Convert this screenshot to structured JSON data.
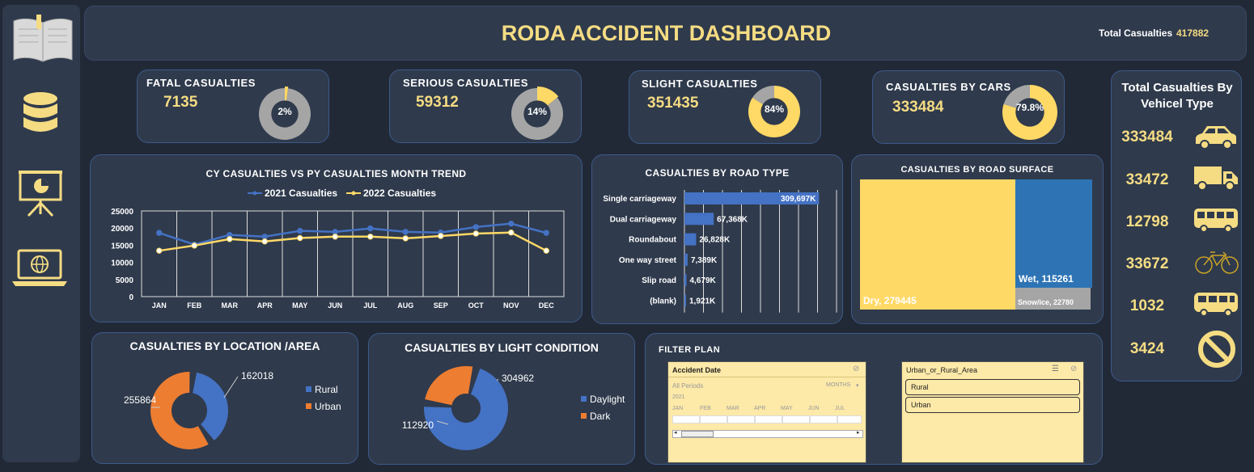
{
  "header": {
    "title": "RODA ACCIDENT DASHBOARD",
    "total_label": "Total Casualties",
    "total_value": "417882"
  },
  "sidebar": {
    "icons": [
      "book-icon",
      "database-icon",
      "presentation-icon",
      "laptop-globe-icon"
    ]
  },
  "kpis": [
    {
      "label": "FATAL CASUALTIES",
      "value": "7135",
      "pct": 2,
      "pct_label": "2%"
    },
    {
      "label": "SERIOUS CASUALTIES",
      "value": "59312",
      "pct": 14,
      "pct_label": "14%"
    },
    {
      "label": "SLIGHT CASUALTIES",
      "value": "351435",
      "pct": 84,
      "pct_label": "84%"
    },
    {
      "label": "CASUALTIES BY CARS",
      "value": "333484",
      "pct": 79.8,
      "pct_label": "79.8%"
    }
  ],
  "colors": {
    "accent": "#f5dc83",
    "blue": "#4472c4",
    "orange": "#ed7d31",
    "grey": "#a5a5a5",
    "yellow": "#ffd966",
    "card": "#2f3a4c",
    "bg": "#222936"
  },
  "trend": {
    "title": "CY CASUALTIES VS PY CASUALTIES MONTH TREND"
  },
  "road_type": {
    "title": "CASUALTIES BY ROAD TYPE"
  },
  "road_surface": {
    "title": "CASUALTIES BY ROAD SURFACE",
    "dry": "Dry, 279445",
    "wet": "Wet, 115261",
    "snow": "Snow/ice, 22780"
  },
  "location": {
    "title": "CASUALTIES BY LOCATION /AREA"
  },
  "light": {
    "title": "CASUALTIES BY  LIGHT CONDITION"
  },
  "vehicle": {
    "title_line1": "Total Casualties By",
    "title_line2": "Vehicel Type",
    "items": [
      {
        "value": "333484",
        "icon": "car-icon"
      },
      {
        "value": "33472",
        "icon": "truck-icon"
      },
      {
        "value": "12798",
        "icon": "bus-icon"
      },
      {
        "value": "33672",
        "icon": "bicycle-icon"
      },
      {
        "value": "1032",
        "icon": "van-icon"
      },
      {
        "value": "3424",
        "icon": "no-entry-icon"
      }
    ]
  },
  "filter": {
    "title": "FILTER PLAN",
    "date_slicer": {
      "title": "Accident  Date",
      "period_label": "All Periods",
      "mode_label": "MONTHS",
      "year": "2021",
      "months": [
        "JAN",
        "FEB",
        "MAR",
        "APR",
        "MAY",
        "JUN",
        "JUL"
      ]
    },
    "area_slicer": {
      "title": "Urban_or_Rural_Area",
      "options": [
        "Rural",
        "Urban"
      ]
    }
  },
  "chart_data": [
    {
      "type": "line",
      "title": "CY CASUALTIES VS PY CASUALTIES MONTH TREND",
      "categories": [
        "JAN",
        "FEB",
        "MAR",
        "APR",
        "MAY",
        "JUN",
        "JUL",
        "AUG",
        "SEP",
        "OCT",
        "NOV",
        "DEC"
      ],
      "series": [
        {
          "name": "2021 Casualties",
          "values": [
            18600,
            15200,
            18000,
            17500,
            19200,
            18900,
            19900,
            18900,
            18700,
            20300,
            21300,
            18600
          ]
        },
        {
          "name": "2022 Casualties",
          "values": [
            13400,
            14900,
            16800,
            16100,
            17100,
            17500,
            17500,
            17000,
            17700,
            18400,
            18700,
            13400
          ]
        }
      ],
      "ylim": [
        0,
        25000
      ],
      "yticks": [
        "0",
        "5000",
        "10000",
        "15000",
        "20000",
        "25000"
      ],
      "grid": true,
      "legend": "top"
    },
    {
      "type": "bar",
      "title": "CASUALTIES BY ROAD TYPE",
      "categories": [
        "Single carriageway",
        "Dual carriageway",
        "Roundabout",
        "One way street",
        "Slip road",
        "(blank)"
      ],
      "values": [
        309697,
        67368,
        26828,
        7389,
        4679,
        1921
      ],
      "labels": [
        "309,697K",
        "67,368K",
        "26,828K",
        "7,389K",
        "4,679K",
        "1,921K"
      ],
      "xlim": [
        0,
        350000
      ]
    },
    {
      "type": "heatmap",
      "title": "CASUALTIES BY ROAD SURFACE",
      "categories": [
        "Dry",
        "Wet",
        "Snow/ice"
      ],
      "values": [
        279445,
        115261,
        22780
      ]
    },
    {
      "type": "pie",
      "title": "CASUALTIES BY LOCATION /AREA",
      "categories": [
        "Rural",
        "Urban"
      ],
      "values": [
        162018,
        255864
      ],
      "labels": [
        "162018",
        "255864"
      ],
      "legend": "right"
    },
    {
      "type": "pie",
      "title": "CASUALTIES BY  LIGHT CONDITION",
      "categories": [
        "Daylight",
        "Dark"
      ],
      "values": [
        304962,
        112920
      ],
      "labels": [
        "304962",
        "112920"
      ],
      "legend": "right"
    }
  ]
}
